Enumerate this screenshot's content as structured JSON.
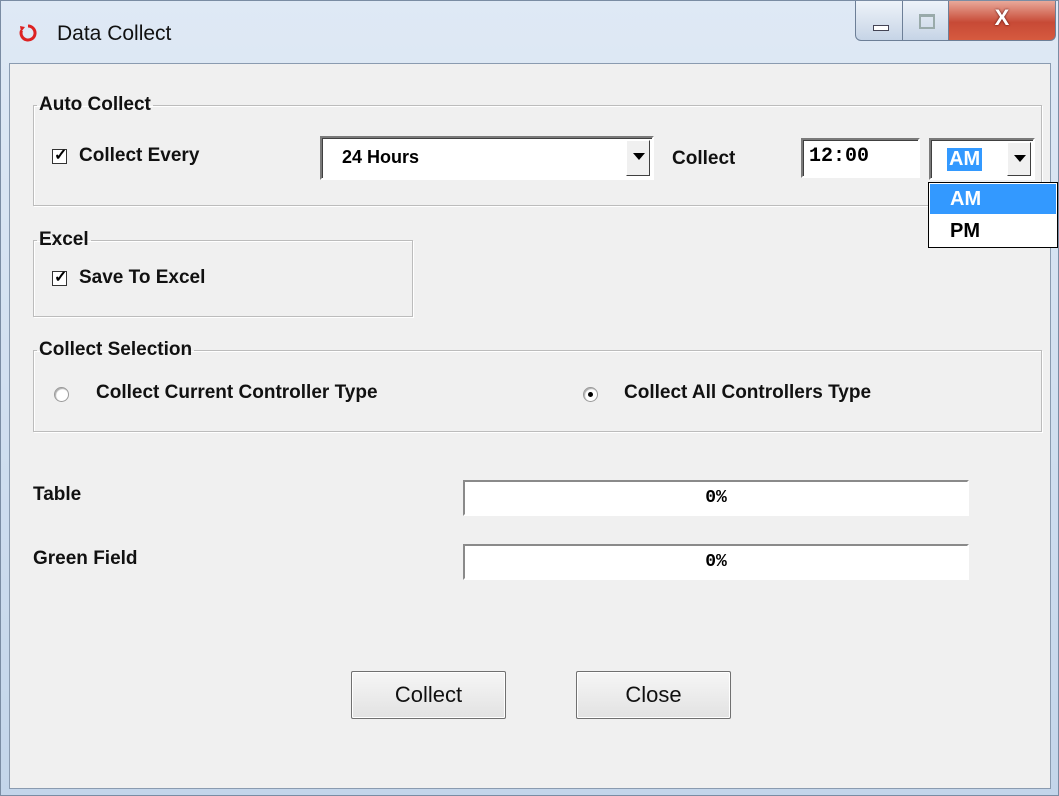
{
  "window": {
    "title": "Data Collect",
    "min_icon": "minimize-icon",
    "max_icon": "maximize-icon",
    "close_label": "X"
  },
  "auto_collect": {
    "legend": "Auto Collect",
    "collect_every_label": "Collect Every",
    "collect_every_checked": true,
    "interval_value": "24 Hours",
    "collect_at_label": "Collect",
    "time_value": "12:00",
    "ampm_value": "AM",
    "ampm_options": [
      "AM",
      "PM"
    ],
    "ampm_selected_index": 0
  },
  "excel": {
    "legend": "Excel",
    "save_label": "Save To Excel",
    "save_checked": true
  },
  "collect_selection": {
    "legend": "Collect Selection",
    "option_current": "Collect Current Controller Type",
    "option_all": "Collect All Controllers Type",
    "selected": "all"
  },
  "progress": {
    "table_label": "Table",
    "table_value": "0%",
    "table_fraction": 0,
    "green_label": "Green Field",
    "green_value": "0%",
    "green_fraction": 0
  },
  "buttons": {
    "collect_label": "Collect",
    "close_label": "Close"
  },
  "colors": {
    "selection": "#3399ff",
    "close_button": "#c74a36"
  }
}
